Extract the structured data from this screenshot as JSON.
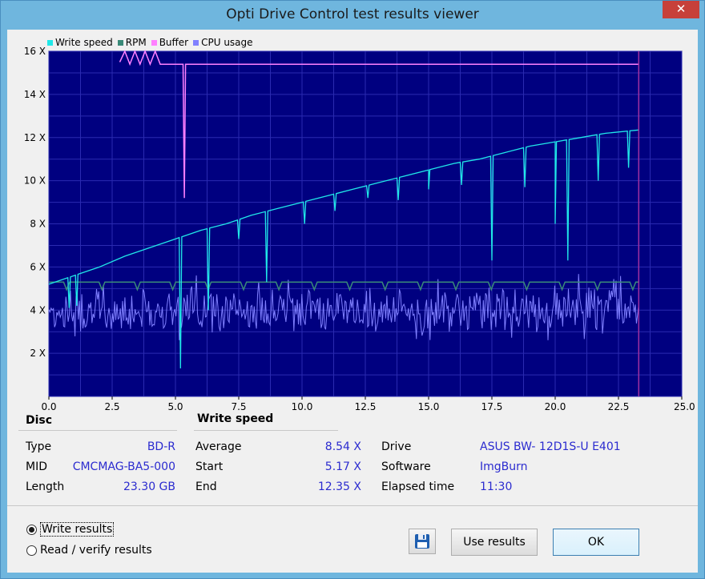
{
  "window": {
    "title": "Opti Drive Control test results viewer",
    "close_glyph": "✕"
  },
  "legend": [
    {
      "label": "Write speed",
      "color": "#20e8e8"
    },
    {
      "label": "RPM",
      "color": "#3a8a78"
    },
    {
      "label": "Buffer",
      "color": "#ff80ff"
    },
    {
      "label": "CPU usage",
      "color": "#8080ff"
    }
  ],
  "chart_data": {
    "type": "line",
    "x_unit": "GB",
    "xlim": [
      0,
      25
    ],
    "ylim": [
      0,
      16
    ],
    "x_ticks": [
      "0.0",
      "2.5",
      "5.0",
      "7.5",
      "10.0",
      "12.5",
      "15.0",
      "17.5",
      "20.0",
      "22.5",
      "25.0 GB"
    ],
    "y_ticks": [
      "2 X",
      "4 X",
      "6 X",
      "8 X",
      "10 X",
      "12 X",
      "14 X",
      "16 X"
    ],
    "background": "#000080",
    "grid": true,
    "end_marker_x": 23.3,
    "series": [
      {
        "name": "Write speed",
        "color": "#20e8e8",
        "x": [
          0,
          1,
          2,
          3,
          4,
          5,
          6,
          7,
          8,
          9,
          10,
          11,
          12,
          13,
          14,
          15,
          16,
          17,
          18,
          19,
          20,
          21,
          22,
          23.3
        ],
        "y": [
          5.2,
          5.6,
          6.0,
          6.5,
          6.9,
          7.3,
          7.7,
          8.0,
          8.4,
          8.7,
          9.0,
          9.3,
          9.6,
          9.9,
          10.2,
          10.5,
          10.8,
          11.0,
          11.3,
          11.6,
          11.8,
          12.0,
          12.2,
          12.35
        ],
        "dips": [
          {
            "x": 0.8,
            "y": 4.1
          },
          {
            "x": 1.1,
            "y": 4.2
          },
          {
            "x": 5.2,
            "y": 1.3
          },
          {
            "x": 6.3,
            "y": 4.0
          },
          {
            "x": 7.5,
            "y": 7.3
          },
          {
            "x": 8.6,
            "y": 5.3
          },
          {
            "x": 10.1,
            "y": 8.0
          },
          {
            "x": 11.3,
            "y": 8.6
          },
          {
            "x": 12.6,
            "y": 9.2
          },
          {
            "x": 13.8,
            "y": 9.1
          },
          {
            "x": 15.0,
            "y": 9.6
          },
          {
            "x": 16.3,
            "y": 9.8
          },
          {
            "x": 17.5,
            "y": 6.3
          },
          {
            "x": 18.8,
            "y": 9.7
          },
          {
            "x": 20.0,
            "y": 8.0
          },
          {
            "x": 20.5,
            "y": 6.3
          },
          {
            "x": 21.7,
            "y": 10.0
          },
          {
            "x": 22.9,
            "y": 10.6
          }
        ]
      },
      {
        "name": "RPM",
        "color": "#3a8a78",
        "x": [
          0,
          23.3
        ],
        "y": [
          5.3,
          5.3
        ]
      },
      {
        "name": "Buffer",
        "color": "#ff80ff",
        "x": [
          2.8,
          3.0,
          3.2,
          3.4,
          3.6,
          3.8,
          4.0,
          4.2,
          4.4,
          4.6,
          5.3,
          5.35,
          5.4,
          5.45,
          23.3
        ],
        "y": [
          15.5,
          16.0,
          15.4,
          16.0,
          15.4,
          16.0,
          15.4,
          16.0,
          15.4,
          15.4,
          15.4,
          9.2,
          15.4,
          15.4,
          15.4
        ]
      },
      {
        "name": "CPU usage",
        "color": "#8080ff",
        "x": [
          0,
          23.3
        ],
        "y": [
          4.0,
          4.0
        ],
        "noise_range": [
          2.6,
          5.7
        ]
      }
    ]
  },
  "disc": {
    "heading": "Disc",
    "rows": [
      {
        "label": "Type",
        "value": "BD-R"
      },
      {
        "label": "MID",
        "value": "CMCMAG-BA5-000"
      },
      {
        "label": "Length",
        "value": "23.30 GB"
      }
    ]
  },
  "write_speed": {
    "heading": "Write speed",
    "rows": [
      {
        "label": "Average",
        "value": "8.54 X"
      },
      {
        "label": "Start",
        "value": "5.17 X"
      },
      {
        "label": "End",
        "value": "12.35 X"
      }
    ]
  },
  "drive_info": {
    "rows": [
      {
        "label": "Drive",
        "value": "ASUS BW- 12D1S-U E401"
      },
      {
        "label": "Software",
        "value": "ImgBurn"
      },
      {
        "label": "Elapsed time",
        "value": "11:30"
      }
    ]
  },
  "options": {
    "write_results": "Write results",
    "read_verify_results": "Read / verify results",
    "selected": "write_results"
  },
  "buttons": {
    "save_icon": "floppy-disk",
    "use_results": "Use results",
    "ok": "OK"
  }
}
